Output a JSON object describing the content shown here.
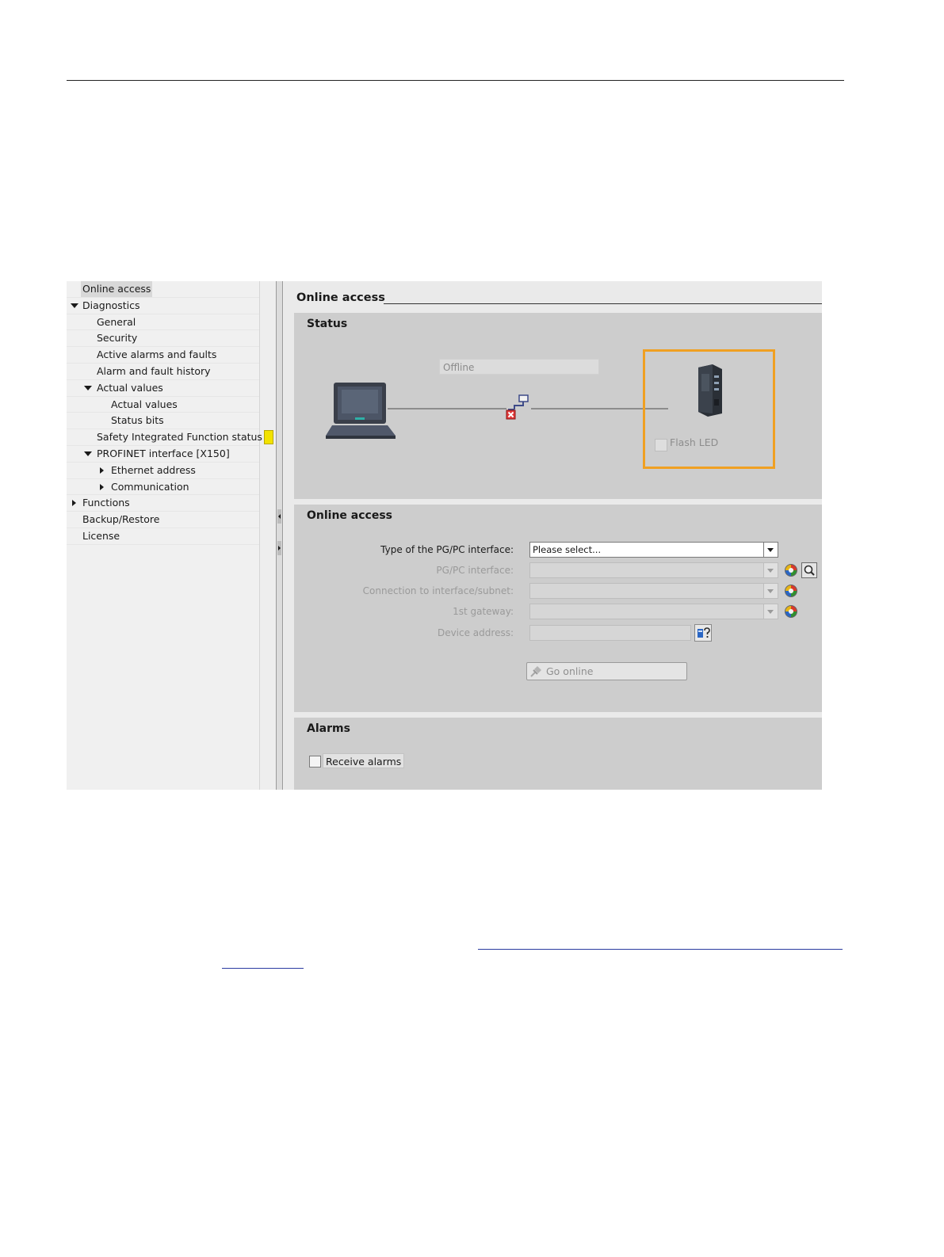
{
  "tree": {
    "items": [
      {
        "label": "Online access",
        "selected": true
      },
      {
        "label": "Diagnostics",
        "expander": "expanded"
      },
      {
        "label": "General"
      },
      {
        "label": "Security"
      },
      {
        "label": "Active alarms and faults"
      },
      {
        "label": "Alarm and fault history"
      },
      {
        "label": "Actual values",
        "expander": "expanded"
      },
      {
        "label": "Actual values"
      },
      {
        "label": "Status bits"
      },
      {
        "label": "Safety Integrated Function status",
        "status_color": "#f2e200"
      },
      {
        "label": "PROFINET interface [X150]",
        "expander": "expanded"
      },
      {
        "label": "Ethernet address",
        "expander": "collapsed"
      },
      {
        "label": "Communication",
        "expander": "collapsed"
      },
      {
        "label": "Functions",
        "expander": "collapsed"
      },
      {
        "label": "Backup/Restore"
      },
      {
        "label": "License"
      }
    ]
  },
  "main": {
    "title": "Online access"
  },
  "status_panel": {
    "title": "Status",
    "connection_state": "Offline",
    "device": {
      "flash_led_label": "Flash LED",
      "flash_led_checked": false,
      "highlight_color": "#f0a022"
    }
  },
  "online_panel": {
    "title": "Online access",
    "fields": {
      "type_pgpc": {
        "label": "Type of the PG/PC interface:",
        "value": "Please select..."
      },
      "pgpc_interface": {
        "label": "PG/PC interface:",
        "value": ""
      },
      "connection_subnet": {
        "label": "Connection to interface/subnet:",
        "value": ""
      },
      "first_gateway": {
        "label": "1st gateway:",
        "value": ""
      },
      "device_address": {
        "label": "Device address:",
        "value": ""
      }
    },
    "go_online_label": "Go online"
  },
  "alarms_panel": {
    "title": "Alarms",
    "receive_label": "Receive alarms",
    "receive_checked": false
  }
}
